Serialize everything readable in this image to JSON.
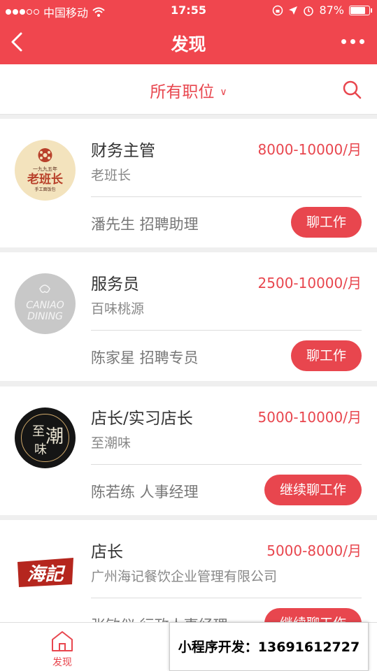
{
  "status": {
    "carrier": "中国移动",
    "time": "17:55",
    "battery": "87%",
    "battery_level": 0.87
  },
  "nav": {
    "title": "发现"
  },
  "filter": {
    "label": "所有职位"
  },
  "jobs": [
    {
      "title": "财务主管",
      "salary": "8000-10000/月",
      "company": "老班长",
      "contact": "潘先生 招聘助理",
      "action": "聊工作",
      "logo": {
        "top": "一九九五年",
        "main": "老班长",
        "sub": "手工面饭包"
      }
    },
    {
      "title": "服务员",
      "salary": "2500-10000/月",
      "company": "百味桃源",
      "contact": "陈家星 招聘专员",
      "action": "聊工作",
      "logo": {
        "line1": "CANIAO",
        "line2": "DINING"
      }
    },
    {
      "title": "店长/实习店长",
      "salary": "5000-10000/月",
      "company": "至潮味",
      "contact": "陈若练 人事经理",
      "action": "继续聊工作",
      "logo": {
        "c1": "至",
        "c2": "潮",
        "c3": "味"
      }
    },
    {
      "title": "店长",
      "salary": "5000-8000/月",
      "company": "广州海记餐饮企业管理有限公司",
      "contact": "张敏仪 行政人事经理",
      "action": "继续聊工作",
      "logo": {
        "text": "海記"
      }
    }
  ],
  "tabbar": {
    "discover": "发现"
  },
  "watermark": "小程序开发：13691612727",
  "colors": {
    "brand": "#f0464e",
    "accent": "#e8464e"
  }
}
